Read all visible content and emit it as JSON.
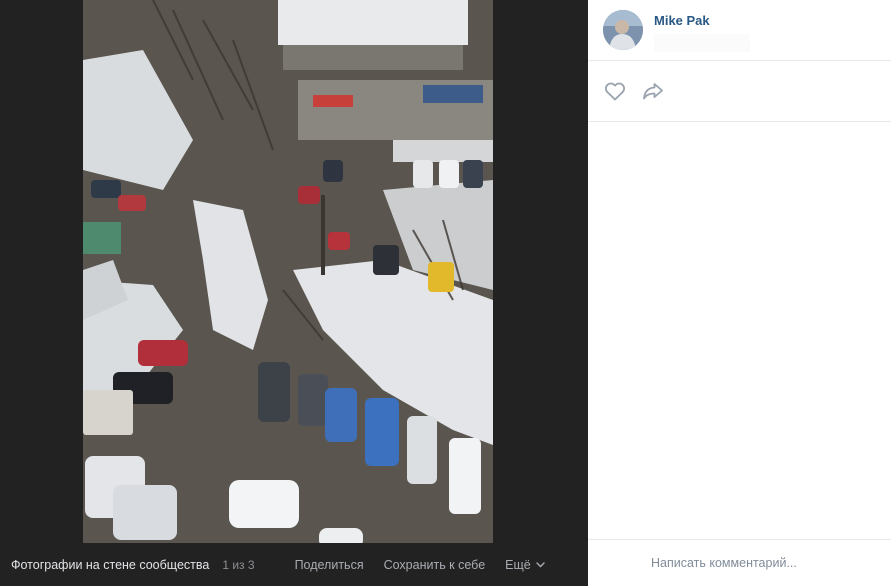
{
  "viewer": {
    "album_title": "Фотографии на стене сообщества",
    "counter": "1 из 3",
    "share_label": "Поделиться",
    "save_label": "Сохранить к себе",
    "more_label": "Ещё",
    "photo_subject": "aerial-parking-lot-winter"
  },
  "sidebar": {
    "author_name": "Mike Pak",
    "like_icon": "heart-icon",
    "share_icon": "share-arrow-icon",
    "comment_placeholder": "Написать комментарий..."
  },
  "colors": {
    "viewer_bg": "#222222",
    "link": "#2a5885",
    "sidebar_bg": "#ffffff",
    "divider": "#e7e8ec",
    "muted_text": "#818c99"
  }
}
